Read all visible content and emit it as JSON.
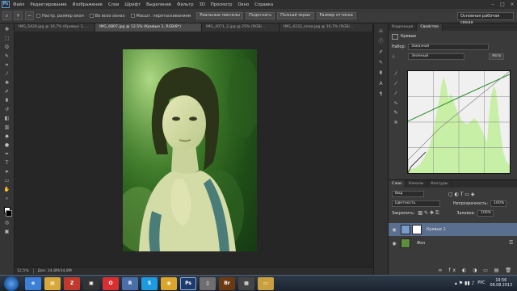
{
  "app": {
    "logo_text": "Ps",
    "menu": [
      "Файл",
      "Редактирование",
      "Изображение",
      "Слои",
      "Шрифт",
      "Выделение",
      "Фильтр",
      "3D",
      "Просмотр",
      "Окно",
      "Справка"
    ]
  },
  "options_bar": {
    "checks": [
      "Настр. размер окон",
      "Во всех окнах",
      "Масшт. перетаскиванием"
    ],
    "buttons": [
      "Реальные пикселы",
      "Подогнать",
      "Полный экран",
      "Размер оттиска"
    ],
    "workspace": "Основная рабочая среда"
  },
  "tabs": [
    {
      "label": "IMG_5428.jpg @ 16,7% (Кривые 1, ...",
      "active": false
    },
    {
      "label": "IMG_6807.jpg @ 12,5% (Кривые 1, RGB/8*)",
      "active": true
    },
    {
      "label": "IMG_4071_2.jpg @ 25% (RGB/...",
      "active": false
    },
    {
      "label": "IMG_4232_snow.jpg @ 16,7% (RGB/...",
      "active": false
    }
  ],
  "status": {
    "zoom": "12,5%",
    "doc": "Док: 34,8M/34,8M"
  },
  "properties": {
    "tabs": [
      "Коррекция",
      "Свойства"
    ],
    "title": "Кривые",
    "preset_label": "Набор:",
    "preset_value": "Заказная",
    "channel_value": "Зеленый",
    "auto_button": "Авто"
  },
  "layers": {
    "tabs": [
      "Слои",
      "Каналы",
      "Контуры"
    ],
    "filter_value": "Вид",
    "blend_mode": "Цветность",
    "opacity_label": "Непрозрачность:",
    "opacity_value": "100%",
    "lock_label": "Закрепить:",
    "fill_label": "Заливка:",
    "fill_value": "100%",
    "items": [
      {
        "name": "Кривые 1",
        "selected": true
      },
      {
        "name": "Фон",
        "selected": false
      }
    ]
  },
  "taskbar": {
    "language": "РУС",
    "time": "19:56",
    "date": "06.08.2013",
    "apps": [
      {
        "icon": "ie-icon",
        "color": "#3b7fd6",
        "glyph": "e"
      },
      {
        "icon": "explorer-icon",
        "color": "#d8a93a",
        "glyph": "▤"
      },
      {
        "icon": "filezilla-icon",
        "color": "#c0392b",
        "glyph": "Z"
      },
      {
        "icon": "terminal-icon",
        "color": "#333333",
        "glyph": "▣"
      },
      {
        "icon": "opera-icon",
        "color": "#d83030",
        "glyph": "O"
      },
      {
        "icon": "app-r-icon",
        "color": "#4a6ea8",
        "glyph": "R"
      },
      {
        "icon": "skype-icon",
        "color": "#1e9be0",
        "glyph": "S"
      },
      {
        "icon": "chrome-icon",
        "color": "#dba42a",
        "glyph": "◉"
      },
      {
        "icon": "photoshop-icon",
        "color": "#1f3b6b",
        "glyph": "Ps"
      },
      {
        "icon": "file-icon",
        "color": "#6e6e6e",
        "glyph": "▯"
      },
      {
        "icon": "bridge-icon",
        "color": "#6b3a12",
        "glyph": "Br"
      },
      {
        "icon": "film-icon",
        "color": "#444444",
        "glyph": "▦"
      },
      {
        "icon": "folder-icon",
        "color": "#c9a040",
        "glyph": "▭"
      }
    ]
  }
}
